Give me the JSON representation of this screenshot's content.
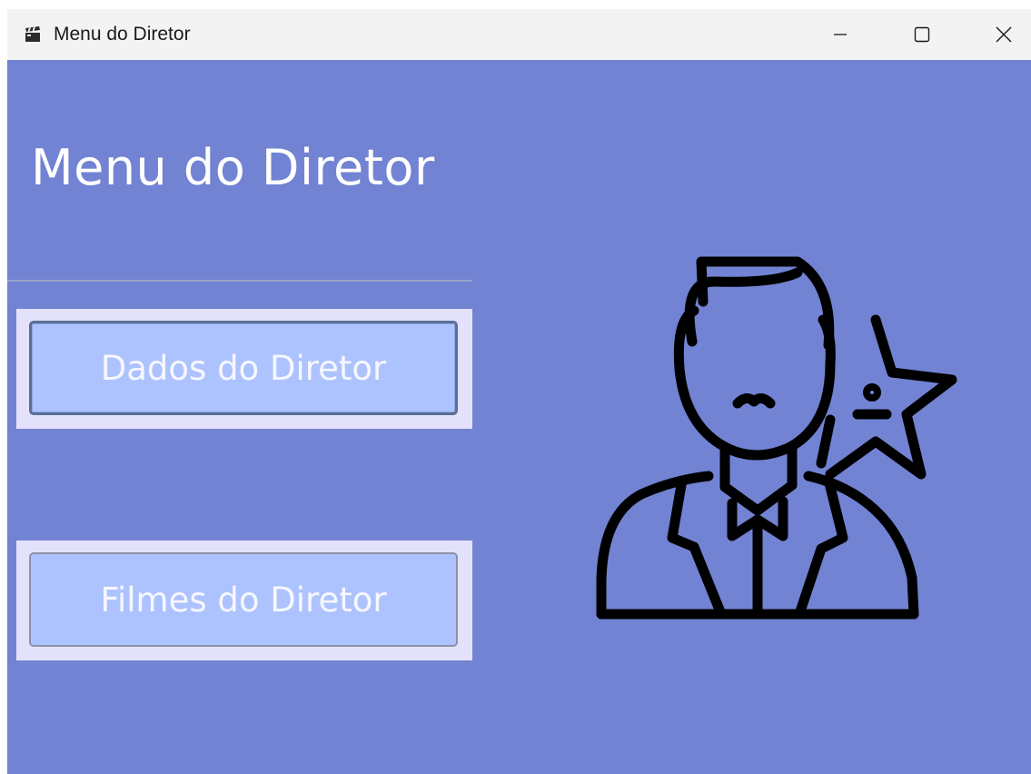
{
  "window": {
    "title": "Menu do Diretor",
    "app_icon": "clapperboard-icon",
    "controls": {
      "minimize_icon": "minimize-icon",
      "maximize_icon": "maximize-icon",
      "close_icon": "close-icon"
    }
  },
  "main": {
    "heading": "Menu do Diretor",
    "buttons": [
      {
        "label": "Dados do Diretor"
      },
      {
        "label": "Filmes do Diretor"
      }
    ],
    "illustration_icon": "director-star-icon"
  },
  "colors": {
    "background": "#7283d3",
    "button_fill": "#adc3ff",
    "button_frame": "#e4e2fb",
    "titlebar": "#f3f3f3"
  }
}
